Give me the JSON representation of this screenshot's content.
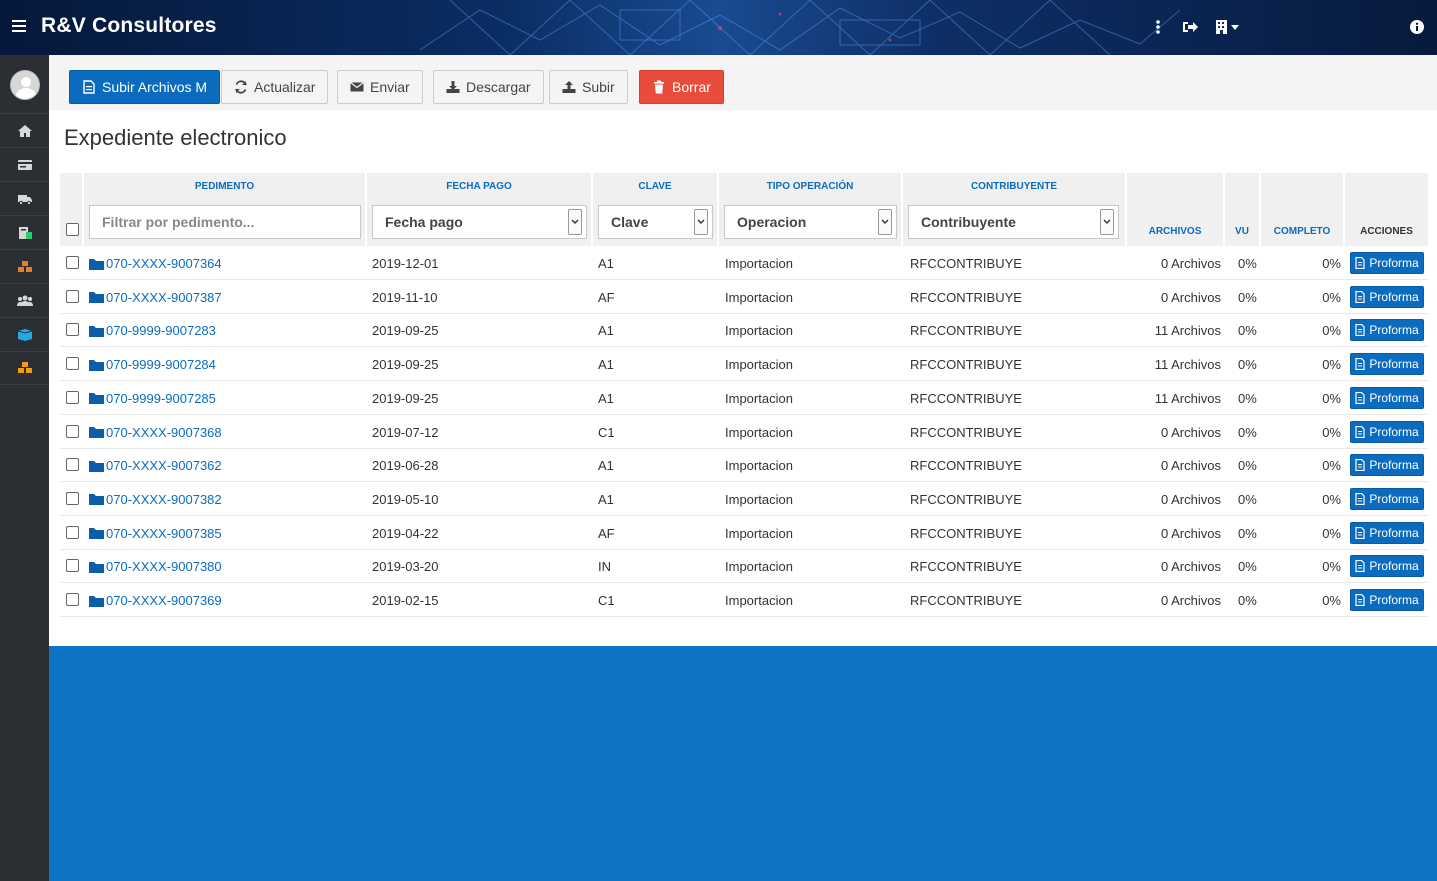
{
  "app": {
    "brand": "R&V Consultores"
  },
  "header_icons": [
    "vertical-dots-icon",
    "sign-out-icon",
    "building-icon",
    "info-icon"
  ],
  "sidebar": {
    "items": [
      "home-icon",
      "card-icon",
      "truck-icon",
      "money-icon",
      "cubes-icon",
      "users-icon",
      "box-icon",
      "cubes-orange-icon"
    ]
  },
  "toolbar": {
    "upload_multi": "Subir Archivos M",
    "refresh": "Actualizar",
    "send": "Enviar",
    "download": "Descargar",
    "upload": "Subir",
    "delete": "Borrar"
  },
  "page": {
    "title": "Expediente electronico"
  },
  "table": {
    "headers": {
      "pedimento": "PEDIMENTO",
      "fecha_pago": "FECHA PAGO",
      "clave": "CLAVE",
      "tipo_operacion": "TIPO OPERACIÓN",
      "contribuyente": "CONTRIBUYENTE",
      "archivos": "ARCHIVOS",
      "vu": "VU",
      "completo": "COMPLETO",
      "acciones": "ACCIONES"
    },
    "filters": {
      "pedimento_placeholder": "Filtrar por pedimento...",
      "fecha_pago": "Fecha pago",
      "clave": "Clave",
      "operacion": "Operacion",
      "contribuyente": "Contribuyente"
    },
    "action_label": "Proforma",
    "rows": [
      {
        "pedimento": "070-XXXX-9007364",
        "fecha": "2019-12-01",
        "clave": "A1",
        "tipo": "Importacion",
        "contribuyente": "RFCCONTRIBUYE",
        "archivos": "0 Archivos",
        "vu": "0%",
        "completo": "0%"
      },
      {
        "pedimento": "070-XXXX-9007387",
        "fecha": "2019-11-10",
        "clave": "AF",
        "tipo": "Importacion",
        "contribuyente": "RFCCONTRIBUYE",
        "archivos": "0 Archivos",
        "vu": "0%",
        "completo": "0%"
      },
      {
        "pedimento": "070-9999-9007283",
        "fecha": "2019-09-25",
        "clave": "A1",
        "tipo": "Importacion",
        "contribuyente": "RFCCONTRIBUYE",
        "archivos": "11 Archivos",
        "vu": "0%",
        "completo": "0%"
      },
      {
        "pedimento": "070-9999-9007284",
        "fecha": "2019-09-25",
        "clave": "A1",
        "tipo": "Importacion",
        "contribuyente": "RFCCONTRIBUYE",
        "archivos": "11 Archivos",
        "vu": "0%",
        "completo": "0%"
      },
      {
        "pedimento": "070-9999-9007285",
        "fecha": "2019-09-25",
        "clave": "A1",
        "tipo": "Importacion",
        "contribuyente": "RFCCONTRIBUYE",
        "archivos": "11 Archivos",
        "vu": "0%",
        "completo": "0%"
      },
      {
        "pedimento": "070-XXXX-9007368",
        "fecha": "2019-07-12",
        "clave": "C1",
        "tipo": "Importacion",
        "contribuyente": "RFCCONTRIBUYE",
        "archivos": "0 Archivos",
        "vu": "0%",
        "completo": "0%"
      },
      {
        "pedimento": "070-XXXX-9007362",
        "fecha": "2019-06-28",
        "clave": "A1",
        "tipo": "Importacion",
        "contribuyente": "RFCCONTRIBUYE",
        "archivos": "0 Archivos",
        "vu": "0%",
        "completo": "0%"
      },
      {
        "pedimento": "070-XXXX-9007382",
        "fecha": "2019-05-10",
        "clave": "A1",
        "tipo": "Importacion",
        "contribuyente": "RFCCONTRIBUYE",
        "archivos": "0 Archivos",
        "vu": "0%",
        "completo": "0%"
      },
      {
        "pedimento": "070-XXXX-9007385",
        "fecha": "2019-04-22",
        "clave": "AF",
        "tipo": "Importacion",
        "contribuyente": "RFCCONTRIBUYE",
        "archivos": "0 Archivos",
        "vu": "0%",
        "completo": "0%"
      },
      {
        "pedimento": "070-XXXX-9007380",
        "fecha": "2019-03-20",
        "clave": "IN",
        "tipo": "Importacion",
        "contribuyente": "RFCCONTRIBUYE",
        "archivos": "0 Archivos",
        "vu": "0%",
        "completo": "0%"
      },
      {
        "pedimento": "070-XXXX-9007369",
        "fecha": "2019-02-15",
        "clave": "C1",
        "tipo": "Importacion",
        "contribuyente": "RFCCONTRIBUYE",
        "archivos": "0 Archivos",
        "vu": "0%",
        "completo": "0%"
      }
    ]
  }
}
